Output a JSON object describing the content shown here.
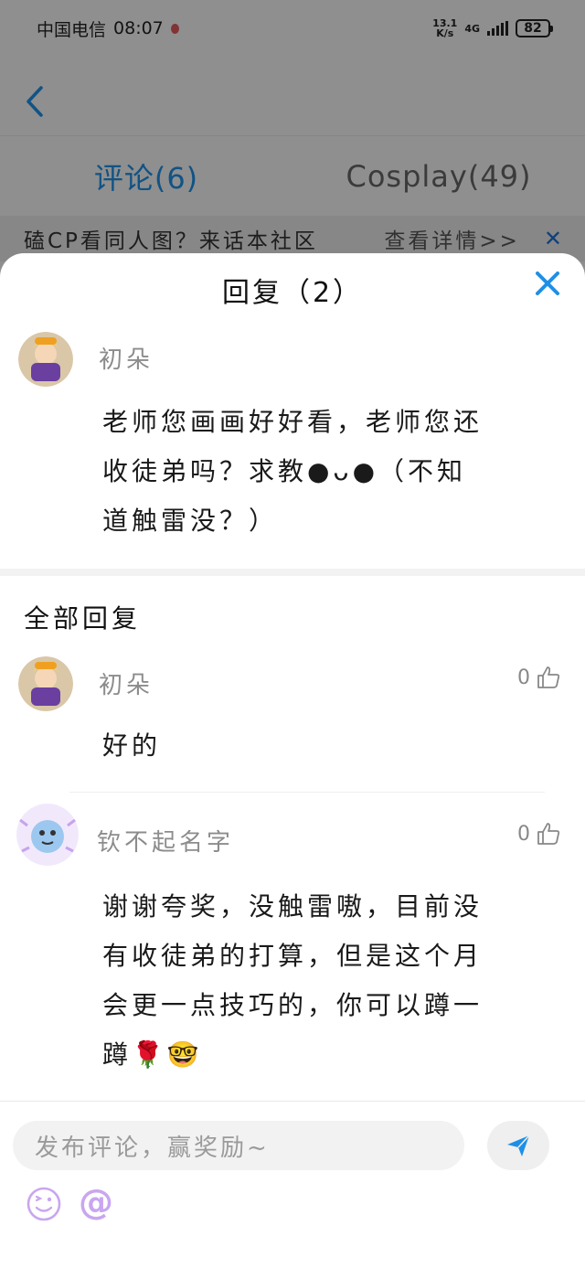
{
  "status_bar": {
    "carrier": "中国电信",
    "time": "08:07",
    "net_speed_value": "13.1",
    "net_speed_unit": "K/s",
    "network": "4G",
    "battery": "82"
  },
  "tabs": [
    {
      "label": "评论(6)",
      "active": true
    },
    {
      "label": "Cosplay(49)",
      "active": false
    }
  ],
  "banner": {
    "text": "磕CP看同人图？来话本社区",
    "link": "查看详情>>",
    "close": "✕"
  },
  "sheet": {
    "title": "回复（2）",
    "close_icon": "close-icon"
  },
  "main_comment": {
    "username": "初朵",
    "text_lines": [
      "老师您画画好好看，老师您还",
      "收徒弟吗？求教●ᴗ●（不知",
      "道触雷没？）"
    ]
  },
  "section_title": "全部回复",
  "replies": [
    {
      "username": "初朵",
      "likes": "0",
      "text_lines": [
        "好的"
      ]
    },
    {
      "username": "钦不起名字",
      "likes": "0",
      "text_lines": [
        "谢谢夸奖，没触雷嗷，目前没",
        "有收徒弟的打算，但是这个月",
        "会更一点技巧的，你可以蹲一",
        "蹲🌹🤓"
      ]
    }
  ],
  "input_bar": {
    "placeholder": "发布评论，赢奖励~",
    "at_label": "@"
  },
  "colors": {
    "accent": "#1e8fe6",
    "send": "#1e8fe6",
    "emoji": "#c9a6f0"
  }
}
